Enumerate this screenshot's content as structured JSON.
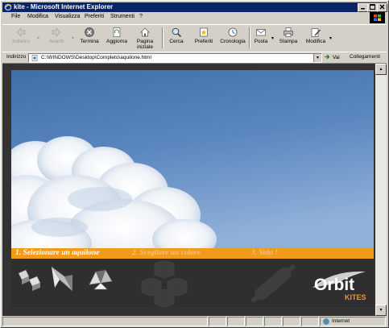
{
  "window": {
    "title": "kite - Microsoft Internet Explorer",
    "controls": [
      "minimize",
      "maximize",
      "close"
    ]
  },
  "menu": {
    "items": [
      {
        "label": "File"
      },
      {
        "label": "Modifica"
      },
      {
        "label": "Visualizza"
      },
      {
        "label": "Preferiti"
      },
      {
        "label": "Strumenti"
      },
      {
        "label": "?"
      }
    ]
  },
  "toolbar": {
    "back": {
      "label": "Indietro",
      "icon": "back-arrow-icon",
      "enabled": false
    },
    "forward": {
      "label": "Avanti",
      "icon": "forward-arrow-icon",
      "enabled": false
    },
    "stop": {
      "label": "Termina",
      "icon": "stop-icon"
    },
    "refresh": {
      "label": "Aggiorna",
      "icon": "refresh-icon"
    },
    "home": {
      "label": "Pagina iniziale",
      "icon": "home-icon"
    },
    "search": {
      "label": "Cerca",
      "icon": "search-icon"
    },
    "favorites": {
      "label": "Preferiti",
      "icon": "favorites-icon"
    },
    "history": {
      "label": "Cronologia",
      "icon": "history-icon"
    },
    "mail": {
      "label": "Posta",
      "icon": "mail-icon"
    },
    "print": {
      "label": "Stampa",
      "icon": "print-icon"
    },
    "edit": {
      "label": "Modifica",
      "icon": "edit-icon"
    }
  },
  "address": {
    "label": "Indirizzo",
    "value": "C:\\WINDOWS\\Desktop\\Completo\\aquilone.html",
    "go_label": "Vai",
    "links_label": "Collegamenti"
  },
  "page": {
    "steps": [
      {
        "label": "1. Selezionare un aquilone",
        "active": true
      },
      {
        "label": "2. Scegliere un colore",
        "active": false
      },
      {
        "label": "3. Vola !",
        "active": false
      }
    ],
    "logo": {
      "name": "Orbit",
      "sub": "KITES"
    },
    "colors": {
      "accent": "#f29a1b",
      "panel": "#2f2f2f",
      "sky": "#5b87c0"
    }
  },
  "status": {
    "zone": "Internet"
  }
}
